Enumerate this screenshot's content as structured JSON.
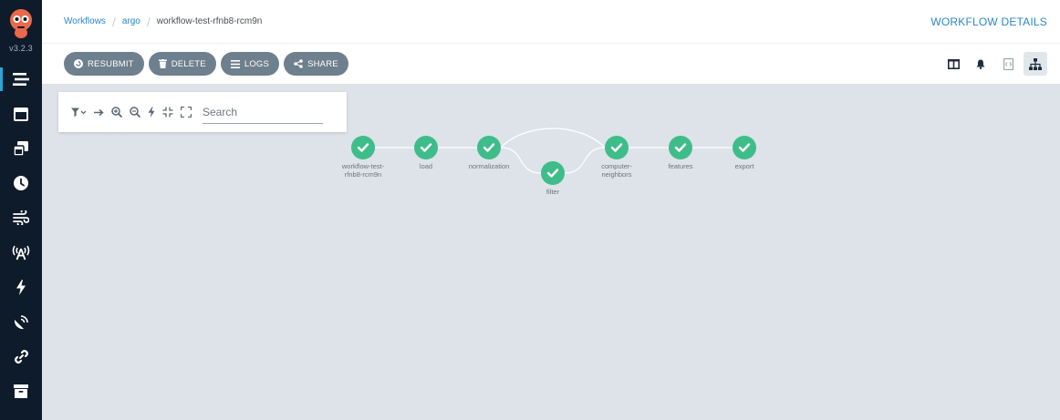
{
  "app": {
    "version": "v3.2.3"
  },
  "breadcrumb": {
    "items": [
      "Workflows",
      "argo",
      "workflow-test-rfnb8-rcm9n"
    ]
  },
  "header": {
    "title": "WORKFLOW DETAILS"
  },
  "toolbar": {
    "resubmit_label": "RESUBMIT",
    "delete_label": "DELETE",
    "logs_label": "LOGS",
    "share_label": "SHARE"
  },
  "graph_panel": {
    "search_placeholder": "Search"
  },
  "colors": {
    "sidebar_bg": "#0e1b2b",
    "accent": "#2b87c8",
    "success": "#3ebd8a",
    "button_bg": "#6e7f8d",
    "canvas_bg": "#dde3e8"
  },
  "sidebar": {
    "items": [
      {
        "name": "workflows",
        "icon": "stream-icon",
        "active": true
      },
      {
        "name": "workflow-templates",
        "icon": "window-icon"
      },
      {
        "name": "cluster-workflow-templates",
        "icon": "clone-icon"
      },
      {
        "name": "cron-workflows",
        "icon": "clock-icon"
      },
      {
        "name": "event-flow",
        "icon": "wind-icon"
      },
      {
        "name": "event-sources",
        "icon": "broadcast-tower-icon"
      },
      {
        "name": "sensors",
        "icon": "bolt-icon"
      },
      {
        "name": "event-bus",
        "icon": "satellite-dish-icon"
      },
      {
        "name": "links",
        "icon": "link-icon"
      },
      {
        "name": "archived-workflows",
        "icon": "archive-icon"
      }
    ]
  },
  "workflow": {
    "nodes": [
      {
        "id": "root",
        "label_lines": [
          "workflow-test-",
          "rfnb8-rcm9n"
        ],
        "status": "succeeded"
      },
      {
        "id": "load",
        "label_lines": [
          "load"
        ],
        "status": "succeeded"
      },
      {
        "id": "normalization",
        "label_lines": [
          "normalization"
        ],
        "status": "succeeded"
      },
      {
        "id": "filter",
        "label_lines": [
          "filter"
        ],
        "status": "succeeded"
      },
      {
        "id": "computer-neighbors",
        "label_lines": [
          "computer-",
          "neighbors"
        ],
        "status": "succeeded"
      },
      {
        "id": "features",
        "label_lines": [
          "features"
        ],
        "status": "succeeded"
      },
      {
        "id": "export",
        "label_lines": [
          "export"
        ],
        "status": "succeeded"
      }
    ],
    "edges": [
      [
        "root",
        "load"
      ],
      [
        "load",
        "normalization"
      ],
      [
        "normalization",
        "filter"
      ],
      [
        "normalization",
        "computer-neighbors"
      ],
      [
        "filter",
        "computer-neighbors"
      ],
      [
        "computer-neighbors",
        "features"
      ],
      [
        "features",
        "export"
      ]
    ]
  }
}
